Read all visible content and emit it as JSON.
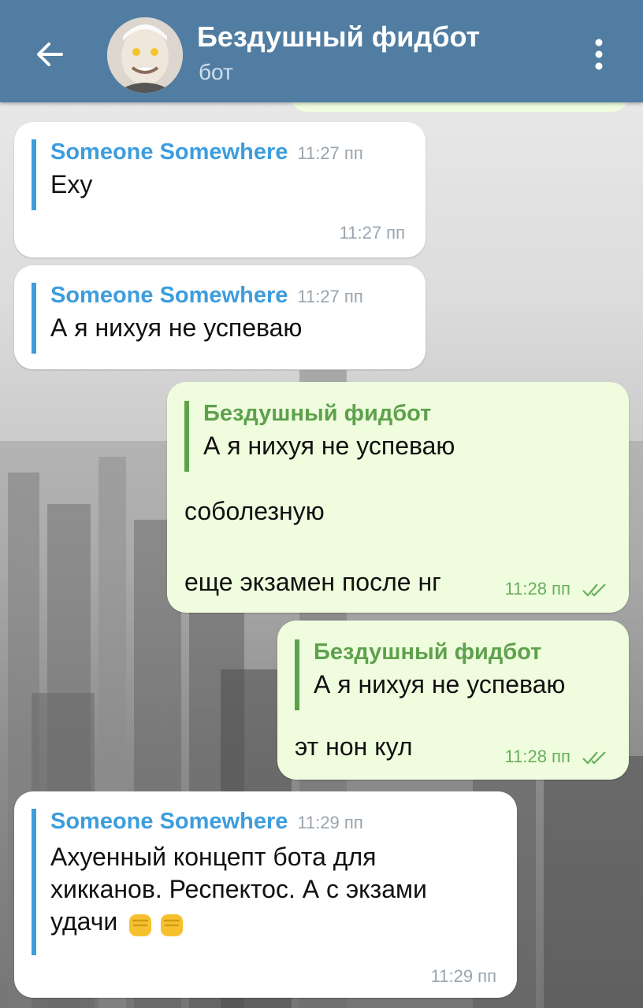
{
  "header": {
    "title": "Бездушный фидбот",
    "subtitle": "бот",
    "back_icon": "arrow-left-icon",
    "menu_icon": "more-vertical-icon"
  },
  "colors": {
    "header_bg": "#517da2",
    "incoming_bubble": "#ffffff",
    "outgoing_bubble": "#effdde",
    "incoming_accent": "#3d9ddd",
    "outgoing_accent": "#5ea14c"
  },
  "messages": [
    {
      "direction": "in",
      "quote": {
        "name": "Someone Somewhere",
        "time": "11:27 пп",
        "text": "Exy"
      },
      "lines": [],
      "time": "11:27 пп"
    },
    {
      "direction": "in",
      "quote": {
        "name": "Someone Somewhere",
        "time": "11:27 пп",
        "text": "А я нихуя не успеваю"
      },
      "lines": [],
      "time": ""
    },
    {
      "direction": "out",
      "quote": {
        "name": "Бездушный фидбот",
        "text": "А я нихуя не успеваю"
      },
      "lines": [
        "соболезную",
        "еще экзамен после нг"
      ],
      "time": "11:28 пп"
    },
    {
      "direction": "out",
      "quote": {
        "name": "Бездушный фидбот",
        "text": "А я нихуя не успеваю"
      },
      "lines": [
        "эт нон кул"
      ],
      "time": "11:28 пп"
    },
    {
      "direction": "in",
      "quote": {
        "name": "Someone Somewhere",
        "time": "11:29 пп",
        "text_lines": [
          "Ахуенный концепт бота для",
          "хикканов. Респектос. А с экзами",
          "удачи"
        ]
      },
      "emoji": "raised-fist-emoji",
      "lines": [],
      "time": "11:29 пп"
    }
  ]
}
